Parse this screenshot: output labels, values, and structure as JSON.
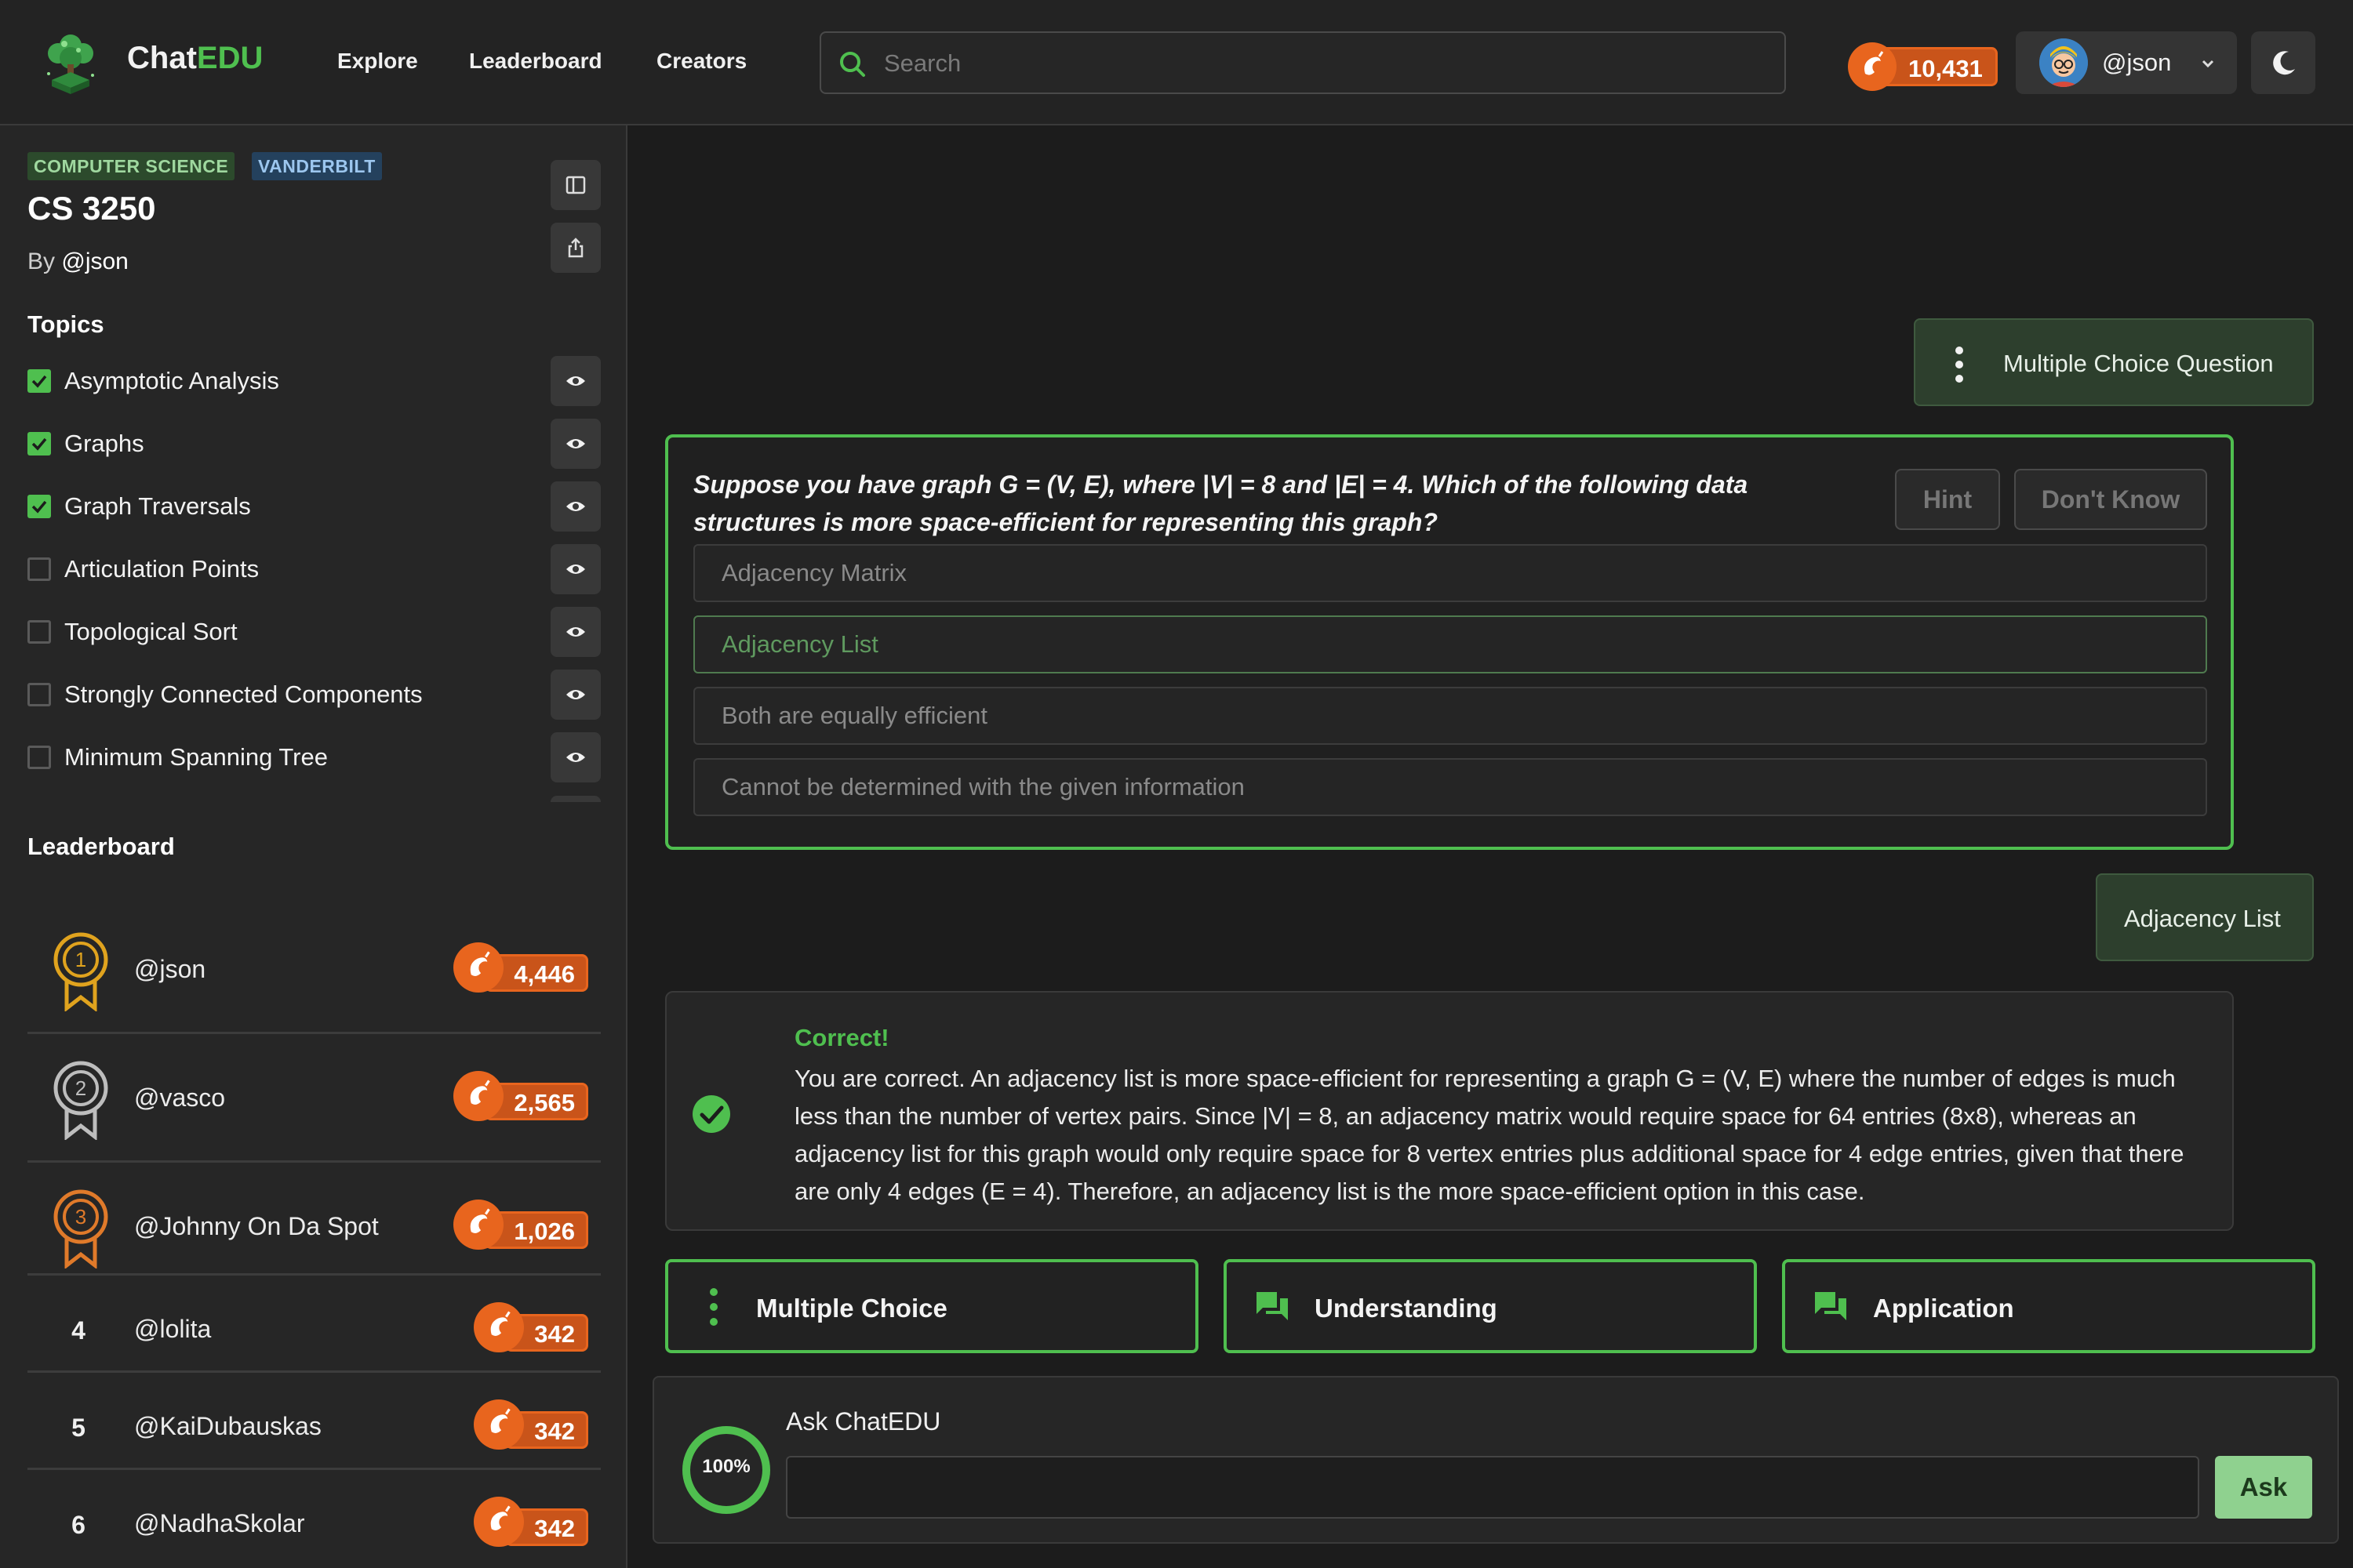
{
  "header": {
    "brand_part1": "Chat",
    "brand_part2": "EDU",
    "nav": [
      "Explore",
      "Leaderboard",
      "Creators"
    ],
    "search_placeholder": "Search",
    "coins": "10,431",
    "username": "@json",
    "accent_color": "#4fbf4f",
    "coin_color": "#e8651e"
  },
  "sidebar": {
    "tags": [
      "COMPUTER SCIENCE",
      "VANDERBILT"
    ],
    "course_title": "CS 3250",
    "by_prefix": "By",
    "author": "@json",
    "topics_heading": "Topics",
    "topics": [
      {
        "label": "Asymptotic Analysis",
        "checked": true
      },
      {
        "label": "Graphs",
        "checked": true
      },
      {
        "label": "Graph Traversals",
        "checked": true
      },
      {
        "label": "Articulation Points",
        "checked": false
      },
      {
        "label": "Topological Sort",
        "checked": false
      },
      {
        "label": "Strongly Connected Components",
        "checked": false
      },
      {
        "label": "Minimum Spanning Tree",
        "checked": false
      }
    ],
    "leaderboard_heading": "Leaderboard",
    "leaderboard": [
      {
        "rank": "1",
        "name": "@json",
        "score": "4,446"
      },
      {
        "rank": "2",
        "name": "@vasco",
        "score": "2,565"
      },
      {
        "rank": "3",
        "name": "@Johnny On Da Spot",
        "score": "1,026"
      },
      {
        "rank": "4",
        "name": "@lolita",
        "score": "342"
      },
      {
        "rank": "5",
        "name": "@KaiDubauskas",
        "score": "342"
      },
      {
        "rank": "6",
        "name": "@NadhaSkolar",
        "score": "342"
      }
    ]
  },
  "chat": {
    "user_chip_1": "Multiple Choice Question",
    "question": "Suppose you have graph G = (V, E), where |V| = 8 and |E| = 4. Which of the following data structures is more space-efficient for representing this graph?",
    "hint_label": "Hint",
    "dont_know_label": "Don't Know",
    "options": [
      "Adjacency Matrix",
      "Adjacency List",
      "Both are equally efficient",
      "Cannot be determined with the given information"
    ],
    "selected_option": "Adjacency List",
    "user_chip_2": "Adjacency List",
    "feedback_title": "Correct!",
    "feedback_body": "You are correct. An adjacency list is more space-efficient for representing a graph G = (V, E) where the number of edges is much less than the number of vertex pairs. Since |V| = 8, an adjacency matrix would require space for 64 entries (8x8), whereas an adjacency list for this graph would only require space for 8 vertex entries plus additional space for 4 edge entries, given that there are only 4 edges (E = 4). Therefore, an adjacency list is the more space-efficient option in this case.",
    "actions": [
      "Multiple Choice",
      "Understanding",
      "Application"
    ],
    "ask_label": "Ask ChatEDU",
    "ask_button": "Ask",
    "progress_text": "100%",
    "progress_value": 1.0
  }
}
